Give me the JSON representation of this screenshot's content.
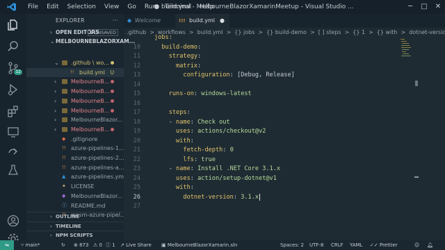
{
  "titlebar": {
    "menu": [
      "File",
      "Edit",
      "Selection",
      "View",
      "Go",
      "Run",
      "Terminal",
      "Help"
    ],
    "window_title": "● build.yml - MelbourneBlazorXamarinMeetup - Visual Studio ...",
    "controls": [
      "─",
      "□",
      "✕"
    ]
  },
  "sidebar": {
    "title": "EXPLORER",
    "more": "···",
    "open_editors": {
      "label": "OPEN EDITORS",
      "badge": "1 UNSAVED"
    },
    "root": {
      "label": "MELBOURNEBLAZORXAM..."
    },
    "items": [
      {
        "name": ".github \\ wo...",
        "kind": "folder-open",
        "status": "dot",
        "color": "#cfc074"
      },
      {
        "name": "build.yml",
        "kind": "yml",
        "status": "U",
        "color": "#cfc074"
      },
      {
        "name": "MelbourneB...",
        "kind": "folder",
        "status": "dot",
        "color": "#e2818a"
      },
      {
        "name": "MelbourneB...",
        "kind": "folder",
        "status": "dot",
        "color": "#e2818a"
      },
      {
        "name": "MelbourneB...",
        "kind": "folder",
        "status": "dot",
        "color": "#e2818a"
      },
      {
        "name": "MelbourneB...",
        "kind": "folder",
        "status": "dot",
        "color": "#e2818a"
      },
      {
        "name": "MelbourneBlazor...",
        "kind": "folder",
        "status": "",
        "color": "#9aa3ab"
      },
      {
        "name": "MelbourneB...",
        "kind": "folder",
        "status": "dot",
        "color": "#e2818a"
      },
      {
        "name": ".gitignore",
        "kind": "git",
        "status": "",
        "color": "#9aa3ab"
      },
      {
        "name": "azure-pipelines-1....",
        "kind": "yml",
        "status": "",
        "color": "#9aa3ab"
      },
      {
        "name": "azure-pipelines-2....",
        "kind": "yml",
        "status": "",
        "color": "#9aa3ab"
      },
      {
        "name": "azure-pipelines-a...",
        "kind": "yml",
        "status": "",
        "color": "#9aa3ab"
      },
      {
        "name": "azure-pipelines.yml",
        "kind": "azure",
        "status": "",
        "color": "#9aa3ab"
      },
      {
        "name": "LICENSE",
        "kind": "license",
        "status": "",
        "color": "#9aa3ab"
      },
      {
        "name": "MelbourneBlazor...",
        "kind": "sln",
        "status": "",
        "color": "#9aa3ab"
      },
      {
        "name": "README.md",
        "kind": "md",
        "status": "",
        "color": "#9aa3ab"
      },
      {
        "name": "wasm-azure-pipel...",
        "kind": "yml",
        "status": "",
        "color": "#9aa3ab"
      }
    ],
    "bottom": [
      "OUTLINE",
      "TIMELINE",
      "NPM SCRIPTS"
    ]
  },
  "tabs": [
    {
      "label": "Welcome",
      "active": false,
      "icon": "vscode-icon"
    },
    {
      "label": "build.yml",
      "active": true,
      "icon": "yml-icon",
      "modified": "●"
    }
  ],
  "breadcrumb": [
    ".github",
    ">",
    "workflows",
    ">",
    "build.yml",
    ">",
    "{} jobs",
    ">",
    "{} build-demo",
    ">",
    "[ ] steps",
    ">",
    "{} 1",
    ">",
    "{} with",
    ">",
    "dotnet-version"
  ],
  "editor": {
    "lines": [
      {
        "n": "",
        "tokens": [
          [
            "k",
            "jobs:"
          ]
        ]
      },
      {
        "n": "10",
        "tokens": [
          [
            "p",
            "  "
          ],
          [
            "k",
            "build-demo"
          ],
          [
            "p",
            ":"
          ]
        ]
      },
      {
        "n": "11",
        "tokens": [
          [
            "p",
            "    "
          ],
          [
            "k",
            "strategy"
          ],
          [
            "p",
            ":"
          ]
        ]
      },
      {
        "n": "12",
        "tokens": [
          [
            "p",
            "      "
          ],
          [
            "k",
            "matrix"
          ],
          [
            "p",
            ":"
          ]
        ]
      },
      {
        "n": "13",
        "tokens": [
          [
            "p",
            "        "
          ],
          [
            "k",
            "configuration"
          ],
          [
            "p",
            ": [Debug, Release]"
          ]
        ]
      },
      {
        "n": "14",
        "tokens": []
      },
      {
        "n": "15",
        "tokens": [
          [
            "p",
            "    "
          ],
          [
            "k",
            "runs-on"
          ],
          [
            "p",
            ": "
          ],
          [
            "s",
            "windows-latest"
          ]
        ]
      },
      {
        "n": "16",
        "tokens": []
      },
      {
        "n": "17",
        "tokens": [
          [
            "p",
            "    "
          ],
          [
            "k",
            "steps"
          ],
          [
            "p",
            ":"
          ]
        ]
      },
      {
        "n": "18",
        "tokens": [
          [
            "p",
            "    - "
          ],
          [
            "k",
            "name"
          ],
          [
            "p",
            ": "
          ],
          [
            "s",
            "Check out"
          ]
        ]
      },
      {
        "n": "19",
        "tokens": [
          [
            "p",
            "      "
          ],
          [
            "k",
            "uses"
          ],
          [
            "p",
            ": "
          ],
          [
            "s",
            "actions/checkout@v2"
          ]
        ]
      },
      {
        "n": "20",
        "tokens": [
          [
            "p",
            "      "
          ],
          [
            "k",
            "with"
          ],
          [
            "p",
            ":"
          ]
        ]
      },
      {
        "n": "21",
        "tokens": [
          [
            "p",
            "        "
          ],
          [
            "k",
            "fetch-depth"
          ],
          [
            "p",
            ": "
          ],
          [
            "s",
            "0"
          ]
        ]
      },
      {
        "n": "22",
        "tokens": [
          [
            "p",
            "        "
          ],
          [
            "k",
            "lfs"
          ],
          [
            "p",
            ": "
          ],
          [
            "s",
            "true"
          ]
        ]
      },
      {
        "n": "23",
        "tokens": [
          [
            "p",
            "    - "
          ],
          [
            "k",
            "name"
          ],
          [
            "p",
            ": "
          ],
          [
            "s",
            "Install .NET Core 3.1.x"
          ]
        ]
      },
      {
        "n": "24",
        "tokens": [
          [
            "p",
            "      "
          ],
          [
            "k",
            "uses"
          ],
          [
            "p",
            ": "
          ],
          [
            "s",
            "action/setup-dotnet@v1"
          ]
        ]
      },
      {
        "n": "25",
        "tokens": [
          [
            "p",
            "      "
          ],
          [
            "k",
            "with"
          ],
          [
            "p",
            ":"
          ]
        ]
      },
      {
        "n": "26",
        "tokens": [
          [
            "p",
            "        "
          ],
          [
            "k",
            "dotnet-version"
          ],
          [
            "p",
            ": "
          ],
          [
            "s",
            "3.1.x"
          ]
        ],
        "current": true
      },
      {
        "n": "27",
        "tokens": []
      }
    ]
  },
  "statusbar": {
    "branch": "main*",
    "sync": "↻",
    "errors": "⊗ 873",
    "warnings": "⚠ 0",
    "infos": "ⓘ 1",
    "live_share": "Live Share",
    "solution": "MelbourneBlazorXamarin.sln",
    "spaces": "Spaces: 2",
    "encoding": "UTF-8",
    "eol": "CRLF",
    "language": "YAML",
    "formatter": "Prettier"
  },
  "colors": {
    "accent": "#2f9a86",
    "keyword": "#e1c46a",
    "string": "#b7dc9b",
    "modified": "#e2818a"
  }
}
